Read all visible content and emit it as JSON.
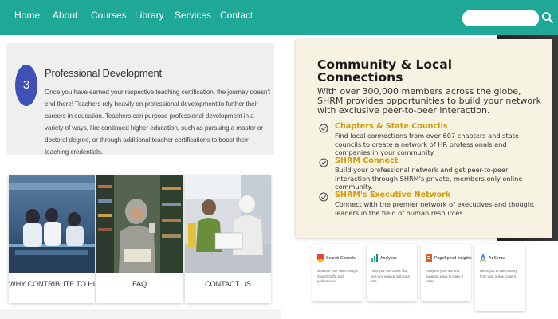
{
  "nav": {
    "items": [
      "Home",
      "About",
      "Courses",
      "Library",
      "Services",
      "Contact"
    ],
    "search_placeholder": "",
    "background": "#1fa898",
    "search_icon": "search-icon"
  },
  "professional_development": {
    "step": "3",
    "title": "Professional Development",
    "text": "Once you have earned your respective teaching certification, the journey doesn't end there! Teachers rely heavily on professional development to further their careers in education. Teachers can purpose professional development in a variety of ways, like continued higher education, such as pursuing a master or doctoral degree, or through additional teacher certifications to boost their teaching credentials.",
    "accent": "#3f51b5"
  },
  "shrm": {
    "title": "Community & Local Connections",
    "intro": "With over 300,000 members across the globe, SHRM provides opportunities to build your network with exclusive peer-to-peer interaction.",
    "items": [
      {
        "head": "Chapters & State Councils",
        "text": "Find local connections from over 607 chapters and state councils to create a network of HR professionals and companies in your community."
      },
      {
        "head": "SHRM Connect",
        "text": "Build your professional network and get peer-to-peer interaction through SHRM's private, members only online community."
      },
      {
        "head": "SHRM's Executive Network",
        "text": "Connect with the premier network of executives and thought leaders in the field of human resources."
      }
    ],
    "accent": "#d69b0b"
  },
  "cards": [
    {
      "label": "WHY CONTRIBUTE TO HU?"
    },
    {
      "label": "FAQ"
    },
    {
      "label": "CONTACT US"
    }
  ],
  "tools": [
    {
      "name": "Search Console",
      "desc": "Measure your site's Google Search traffic and performance",
      "icon": "search-console-icon",
      "color": "#e94235"
    },
    {
      "name": "Analytics",
      "desc": "Tells you how users find, use and engage with your site",
      "icon": "analytics-icon",
      "color": "#2bb5a0"
    },
    {
      "name": "PageSpeed Insights",
      "desc": "Analyzes your site and suggests ways to make it faster",
      "icon": "pagespeed-icon",
      "color": "#e05a2b"
    },
    {
      "name": "AdSense",
      "desc": "Helps you to earn money from your online content",
      "icon": "adsense-icon",
      "color": "#4285f4"
    }
  ]
}
